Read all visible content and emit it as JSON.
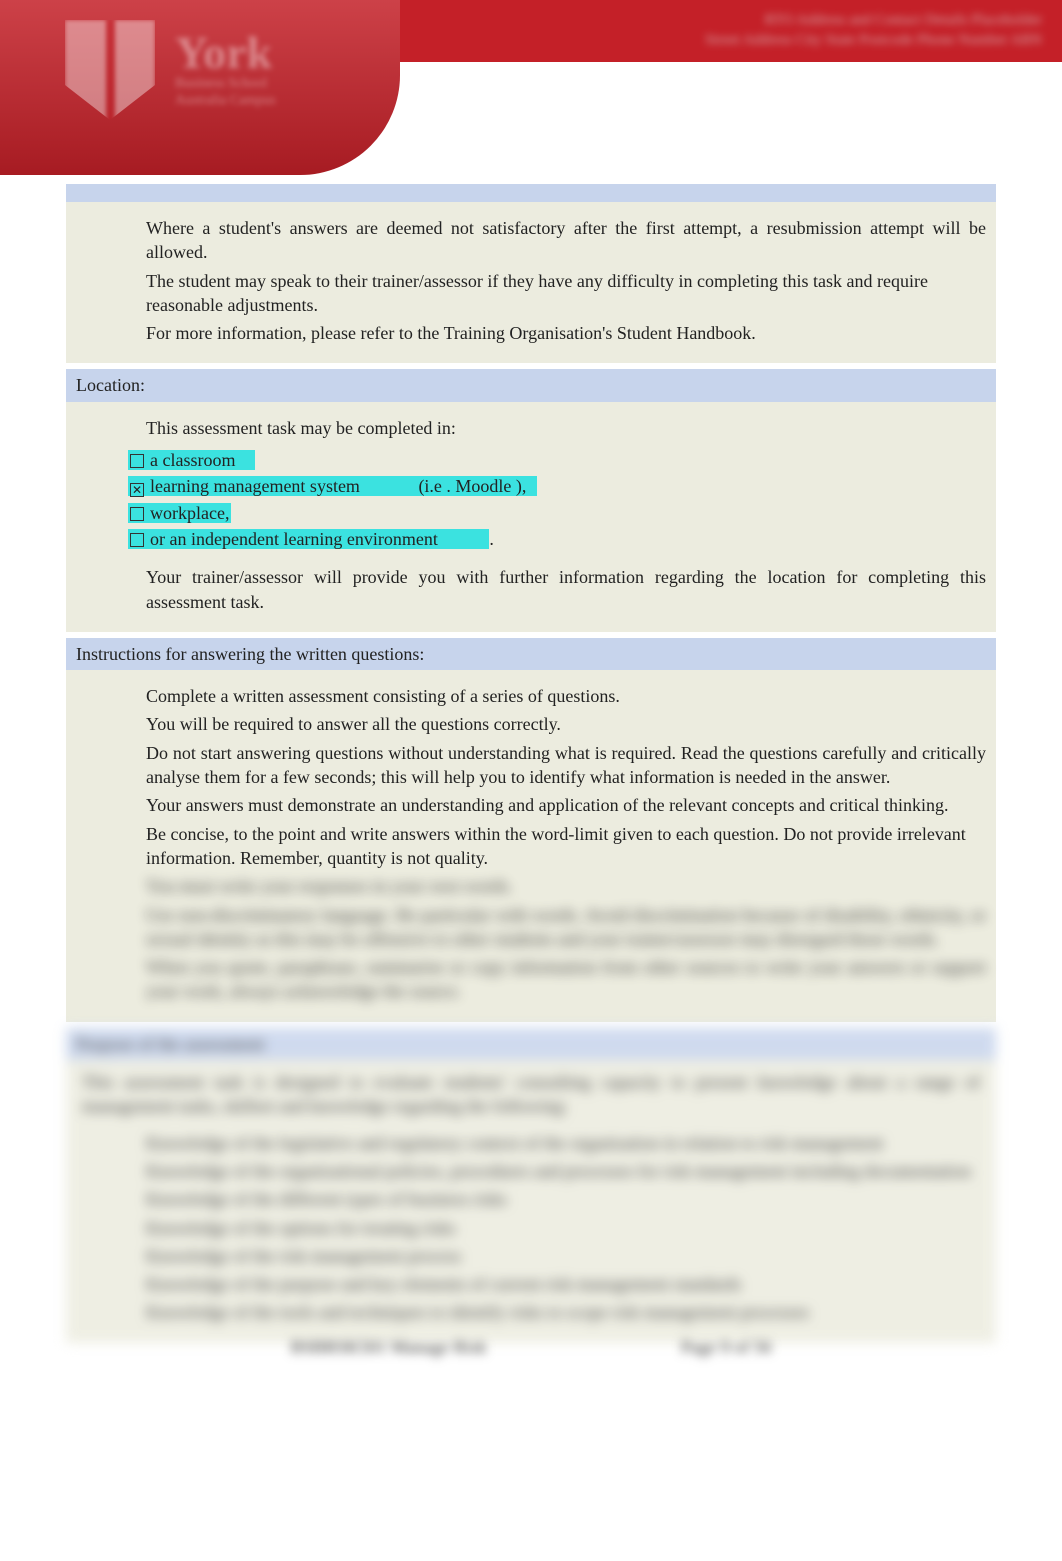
{
  "header": {
    "institution": "York",
    "sub1": "Business School",
    "sub2": "Australia Campus",
    "right_line1": "RTO Address and Contact Details Placeholder",
    "right_line2": "Street Address City State Postcode Phone Number ABN"
  },
  "sections": {
    "pre": {
      "items": [
        "Where a student's answers are deemed not satisfactory after the first attempt, a resubmission attempt will be allowed.",
        "The student may speak to their trainer/assessor if they have any difficulty in completing this task and require reasonable adjustments.",
        "For more information, please refer to the Training Organisation's Student Handbook."
      ]
    },
    "location": {
      "title": "Location:",
      "lead": "This assessment task may be completed in:",
      "options": [
        {
          "checked": false,
          "text": "a classroom"
        },
        {
          "checked": true,
          "text": "learning management system",
          "suffix": "(i.e . Moodle ),"
        },
        {
          "checked": false,
          "text": "workplace,"
        },
        {
          "checked": false,
          "text": "or an independent learning environment",
          "suffix": "."
        }
      ],
      "tail": "Your trainer/assessor will provide you with further information regarding the location for completing this assessment task."
    },
    "instructions": {
      "title": "Instructions for answering the written questions:",
      "items": [
        "Complete a written assessment consisting of a series of questions.",
        "You will be required to answer all the questions correctly.",
        "Do not start answering questions without understanding what is required. Read the questions carefully and critically analyse them for a few seconds; this will help you to identify what information is needed in the answer.",
        "Your answers must demonstrate an understanding and application of the relevant concepts and critical thinking.",
        "Be concise, to the point and write answers within the word-limit given to each question. Do not provide irrelevant information. Remember, quantity is not quality."
      ],
      "blurred_items": [
        "You must write your responses in your own words.",
        "Use non-discriminatory language. Be particular with words. Avoid discrimination because of disability, ethnicity, or sexual identity as this may be offensive to other students and your trainer/assessor may disregard those words.",
        "When you quote, paraphrase, summarise or copy information from other sources to write your answers or support your work, always acknowledge the source."
      ]
    },
    "purpose": {
      "title": "Purpose of the assessment",
      "lead": "This assessment task is designed to evaluate students' consulting capacity to present knowledge about a range of management tasks, skillset and knowledge regarding the following:",
      "items": [
        "Knowledge of the legislative and regulatory context of the organisation in relation to risk management",
        "Knowledge of the organisational policies, procedures and processes for risk management including documentation",
        "Knowledge of the different types of business risks",
        "Knowledge of the options for treating risks",
        "Knowledge of the risk management process",
        "Knowledge of the purpose and key elements of current risk management standards",
        "Knowledge of the tools and techniques to identify risks to scope risk management processes"
      ]
    }
  },
  "footer": {
    "left": "BSBRSK501 Manage Risk",
    "right": "Page 9 of 56"
  }
}
